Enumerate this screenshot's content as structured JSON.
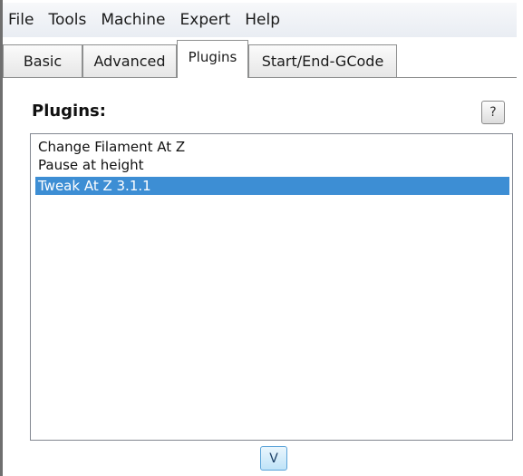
{
  "menubar": {
    "items": [
      "File",
      "Tools",
      "Machine",
      "Expert",
      "Help"
    ]
  },
  "tabs": [
    {
      "label": "Basic",
      "active": false
    },
    {
      "label": "Advanced",
      "active": false
    },
    {
      "label": "Plugins",
      "active": true
    },
    {
      "label": "Start/End-GCode",
      "active": false
    }
  ],
  "plugins": {
    "title": "Plugins:",
    "help_label": "?",
    "items": [
      {
        "label": "Change Filament At Z",
        "selected": false
      },
      {
        "label": "Pause at height",
        "selected": false
      },
      {
        "label": "Tweak At Z 3.1.1",
        "selected": true
      }
    ],
    "down_button_label": "V"
  },
  "colors": {
    "selection": "#3d8ed4",
    "menubar": "#eef1f5",
    "accent_button": "#bfe3f8"
  }
}
